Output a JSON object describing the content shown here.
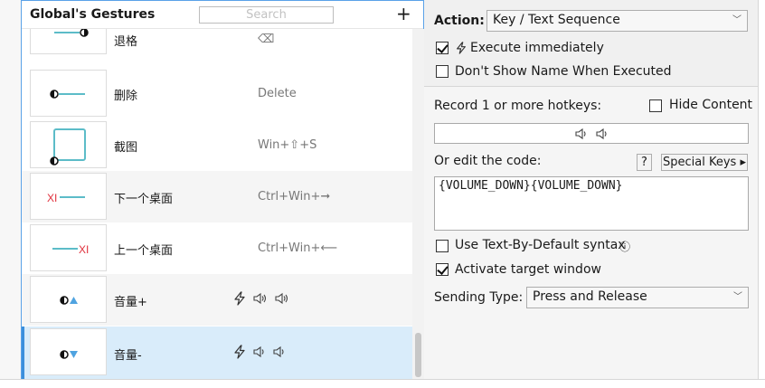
{
  "panel": {
    "title": "Global's Gestures",
    "search_placeholder": "Search",
    "add_label": "+"
  },
  "gestures": [
    {
      "name": "退格",
      "action": "⌫",
      "thumb": "line-left-dot-right"
    },
    {
      "name": "删除",
      "action": "Delete",
      "thumb": "dot-left-line-right"
    },
    {
      "name": "截图",
      "action": "Win+⇧+S",
      "thumb": "square-dot"
    },
    {
      "name": "下一个桌面",
      "action": "Ctrl+Win+➞",
      "thumb": "xl-line"
    },
    {
      "name": "上一个桌面",
      "action": "Ctrl+Win+⟵",
      "thumb": "line-xl"
    },
    {
      "name": "音量+",
      "action_icons": [
        "lightning-icon",
        "volume-up-icon",
        "volume-up-icon"
      ],
      "thumb": "dot-triangle-up"
    },
    {
      "name": "音量-",
      "action_icons": [
        "lightning-icon",
        "volume-down-icon",
        "volume-down-icon"
      ],
      "thumb": "dot-triangle-down",
      "selected": true
    }
  ],
  "settings": {
    "action_label": "Action:",
    "action_value": "Key / Text Sequence",
    "execute_immediately": {
      "label": "Execute immediately",
      "checked": true
    },
    "dont_show_name": {
      "label": "Don't Show Name When Executed",
      "checked": false
    },
    "record_label": "Record 1 or more hotkeys:",
    "hide_content": {
      "label": "Hide Content",
      "checked": false
    },
    "edit_code_label": "Or edit the code:",
    "help_label": "?",
    "special_keys_label": "Special Keys ▸",
    "code": "{VOLUME_DOWN}{VOLUME_DOWN}",
    "text_by_default": {
      "label": "Use Text-By-Default syntax",
      "checked": false,
      "info": "ⓘ"
    },
    "activate_window": {
      "label": "Activate target window",
      "checked": true
    },
    "sending_type_label": "Sending Type:",
    "sending_type_value": "Press and Release"
  },
  "colors": {
    "accent": "#3b8fdc",
    "selected_row": "#d9ecfa",
    "thumb_line": "#5cbcc8",
    "xl_red": "#e0303c",
    "triangle": "#4fa3e0"
  }
}
